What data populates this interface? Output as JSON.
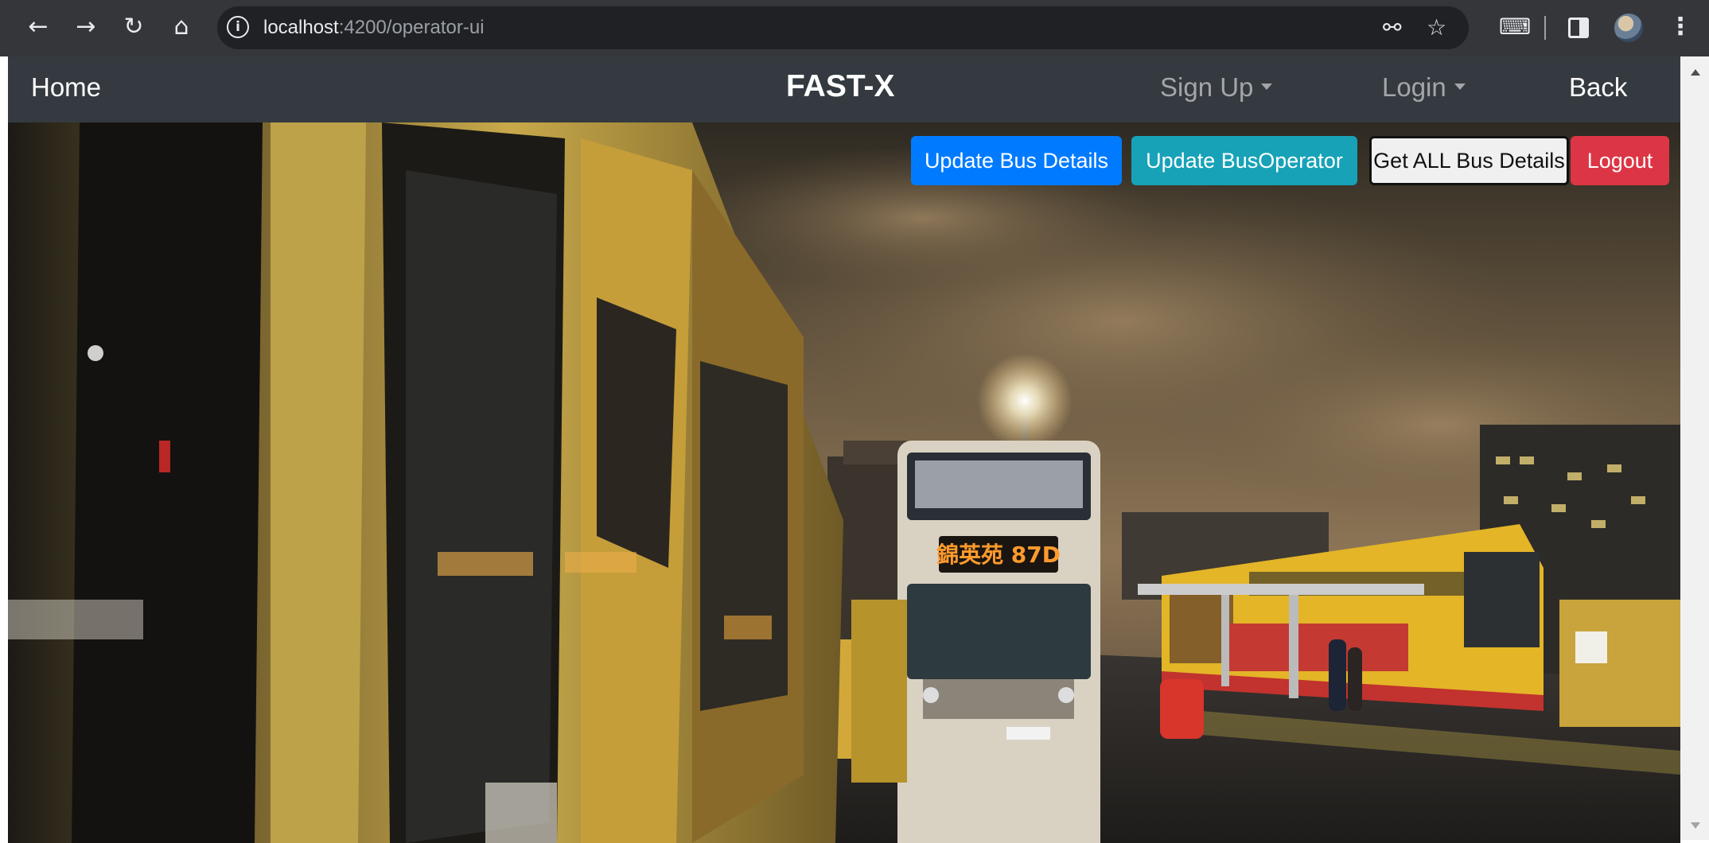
{
  "browser": {
    "url_host": "localhost",
    "url_path": ":4200/operator-ui",
    "icons": [
      "back-arrow-icon",
      "forward-arrow-icon",
      "reload-icon",
      "home-icon",
      "site-info-icon",
      "password-key-icon",
      "bookmark-star-icon",
      "extensions-icon",
      "side-panel-icon",
      "profile-avatar",
      "menu-kebab-icon"
    ]
  },
  "navbar": {
    "home": "Home",
    "brand": "FAST-X",
    "signup": "Sign Up",
    "login": "Login",
    "back": "Back"
  },
  "actions": {
    "update_bus": "Update Bus Details",
    "update_operator": "Update BusOperator",
    "get_all": "Get ALL Bus Details",
    "logout": "Logout"
  },
  "hero": {
    "bus_sign": "錦英苑 87D"
  },
  "colors": {
    "navbar_bg": "#343a40",
    "primary": "#007bff",
    "info": "#17a2b8",
    "danger": "#dc3545",
    "light": "#f0f0f0"
  }
}
